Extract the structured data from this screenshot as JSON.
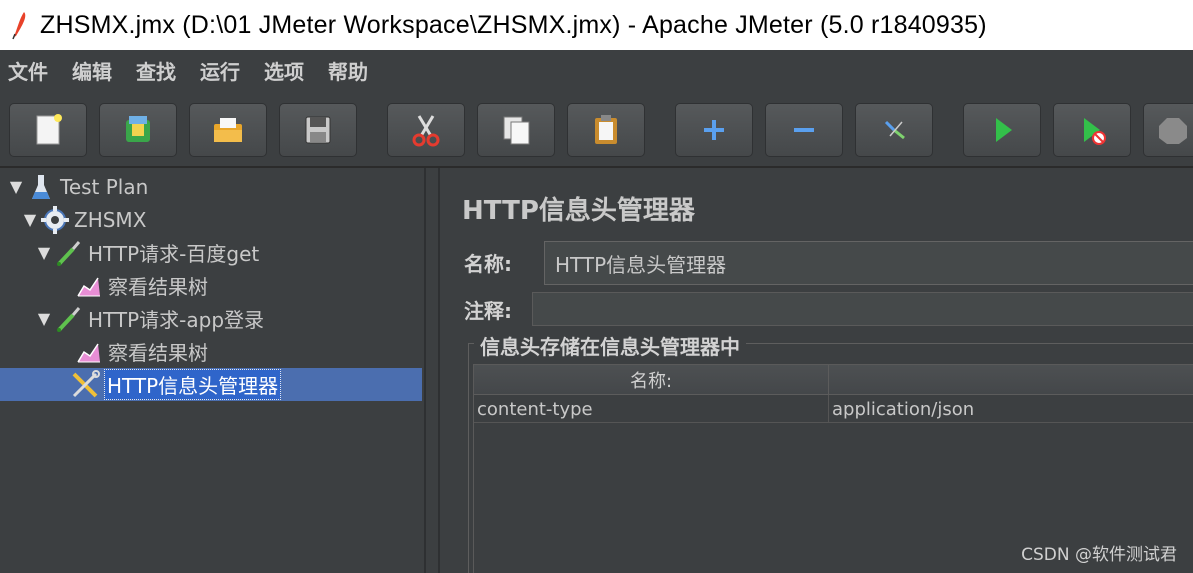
{
  "window": {
    "title": "ZHSMX.jmx (D:\\01 JMeter Workspace\\ZHSMX.jmx) - Apache JMeter (5.0 r1840935)",
    "app_icon": "feather-icon"
  },
  "menu": [
    "文件",
    "编辑",
    "查找",
    "运行",
    "选项",
    "帮助"
  ],
  "toolbar": [
    {
      "name": "new-icon"
    },
    {
      "name": "templates-icon"
    },
    {
      "name": "open-icon"
    },
    {
      "name": "save-icon"
    },
    {
      "name": "cut-icon"
    },
    {
      "name": "copy-icon"
    },
    {
      "name": "paste-icon"
    },
    {
      "name": "expand-icon"
    },
    {
      "name": "collapse-icon"
    },
    {
      "name": "toggle-icon"
    },
    {
      "name": "start-icon"
    },
    {
      "name": "start-no-timers-icon"
    },
    {
      "name": "stop-icon"
    }
  ],
  "tree": [
    {
      "label": "Test Plan",
      "icon": "flask-icon",
      "expanded": true
    },
    {
      "label": "ZHSMX",
      "icon": "gear-icon",
      "expanded": true
    },
    {
      "label": "HTTP请求-百度get",
      "icon": "pipette-icon",
      "expanded": true
    },
    {
      "label": "察看结果树",
      "icon": "chart-icon"
    },
    {
      "label": "HTTP请求-app登录",
      "icon": "pipette-icon",
      "expanded": true
    },
    {
      "label": "察看结果树",
      "icon": "chart-icon"
    },
    {
      "label": "HTTP信息头管理器",
      "icon": "tools-icon",
      "selected": true
    }
  ],
  "panel": {
    "title": "HTTP信息头管理器",
    "name_label": "名称:",
    "name_value": "HTTP信息头管理器",
    "comment_label": "注释:",
    "comment_value": "",
    "group_title": "信息头存储在信息头管理器中",
    "table": {
      "headers": [
        "名称:",
        ""
      ],
      "rows": [
        [
          "content-type",
          "application/json"
        ]
      ]
    }
  },
  "watermark": "CSDN @软件测试君"
}
